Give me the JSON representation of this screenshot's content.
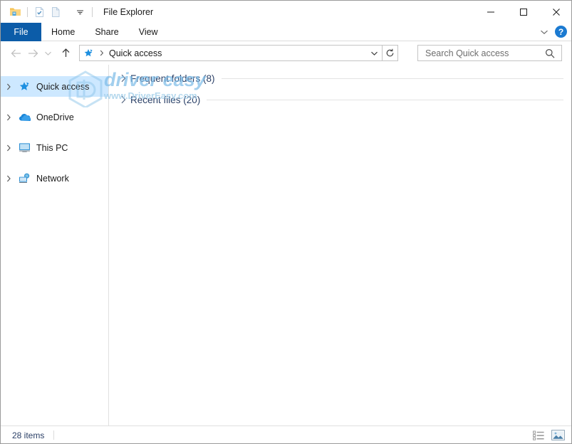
{
  "window": {
    "title": "File Explorer",
    "quick_access_toolbar": [
      {
        "name": "explorer-folder-icon",
        "label": "File Explorer"
      },
      {
        "name": "properties-icon",
        "label": "Properties"
      },
      {
        "name": "new-folder-icon",
        "label": "New folder"
      },
      {
        "name": "customize-qat-chevron-icon",
        "label": "Customize Quick Access Toolbar"
      }
    ],
    "controls": {
      "minimize": "Minimize",
      "maximize": "Maximize",
      "close": "Close"
    }
  },
  "ribbon": {
    "tabs": [
      {
        "label": "File",
        "active": true
      },
      {
        "label": "Home",
        "active": false
      },
      {
        "label": "Share",
        "active": false
      },
      {
        "label": "View",
        "active": false
      }
    ],
    "collapse_label": "Expand the Ribbon",
    "help_label": "?",
    "file_tab_color": "#0c5ca8"
  },
  "navigation": {
    "back_label": "Back",
    "forward_label": "Forward",
    "recent_label": "Recent locations",
    "up_label": "Up",
    "address": {
      "icon": "quick-access-star-icon",
      "crumb": "Quick access",
      "separator": "›",
      "dropdown_label": "Previous locations",
      "refresh_label": "Refresh"
    },
    "search": {
      "placeholder": "Search Quick access",
      "value": "",
      "icon": "search-magnifier-icon"
    }
  },
  "sidebar": {
    "items": [
      {
        "label": "Quick access",
        "icon": "quick-access-star-icon",
        "selected": true,
        "expandable": true
      },
      {
        "label": "OneDrive",
        "icon": "onedrive-cloud-icon",
        "selected": false,
        "expandable": true
      },
      {
        "label": "This PC",
        "icon": "this-pc-monitor-icon",
        "selected": false,
        "expandable": true
      },
      {
        "label": "Network",
        "icon": "network-icon",
        "selected": false,
        "expandable": true
      }
    ],
    "selection_color": "#cde8ff"
  },
  "content": {
    "groups": [
      {
        "title": "Frequent folders (8)",
        "expanded": false,
        "count": 8
      },
      {
        "title": "Recent files (20)",
        "expanded": false,
        "count": 20
      }
    ],
    "group_title_color": "#2a3f66"
  },
  "watermark": {
    "text": "driver easy",
    "subtext": "www.DriverEasy.com",
    "logo": "hexagon-logo-icon",
    "color": "#7fbde8"
  },
  "statusbar": {
    "items_text": "28 items",
    "views": [
      {
        "name": "details-view-button",
        "label": "Details",
        "active": false
      },
      {
        "name": "large-icons-view-button",
        "label": "Large icons",
        "active": true
      }
    ]
  }
}
